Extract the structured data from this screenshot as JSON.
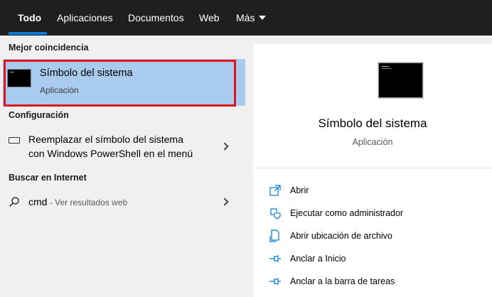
{
  "tabs": [
    {
      "label": "Todo",
      "active": true
    },
    {
      "label": "Aplicaciones",
      "active": false
    },
    {
      "label": "Documentos",
      "active": false
    },
    {
      "label": "Web",
      "active": false
    },
    {
      "label": "Más",
      "active": false,
      "icon": "caret-down-icon"
    }
  ],
  "left": {
    "best_match_header": "Mejor coincidencia",
    "best_match": {
      "title": "Símbolo del sistema",
      "subtitle": "Aplicación",
      "icon": "cmd-icon"
    },
    "settings_header": "Configuración",
    "settings_item": {
      "line1": "Reemplazar el símbolo del sistema",
      "line2": "con Windows PowerShell en el menú",
      "icon": "keyboard-icon"
    },
    "web_header": "Buscar en Internet",
    "web_item": {
      "query": "cmd",
      "suffix": " - Ver resultados web",
      "icon": "search-icon"
    }
  },
  "right": {
    "title": "Símbolo del sistema",
    "subtitle": "Aplicación",
    "actions": [
      {
        "label": "Abrir",
        "icon": "open-icon"
      },
      {
        "label": "Ejecutar como administrador",
        "icon": "shield-icon"
      },
      {
        "label": "Abrir ubicación de archivo",
        "icon": "file-location-icon"
      },
      {
        "label": "Anclar a Inicio",
        "icon": "pin-icon"
      },
      {
        "label": "Anclar a la barra de tareas",
        "icon": "pin-taskbar-icon"
      }
    ]
  },
  "colors": {
    "accent": "#0078d7",
    "selection": "#a9cbed",
    "highlight_border": "#e0141e",
    "topbar": "#1f1f1f"
  }
}
